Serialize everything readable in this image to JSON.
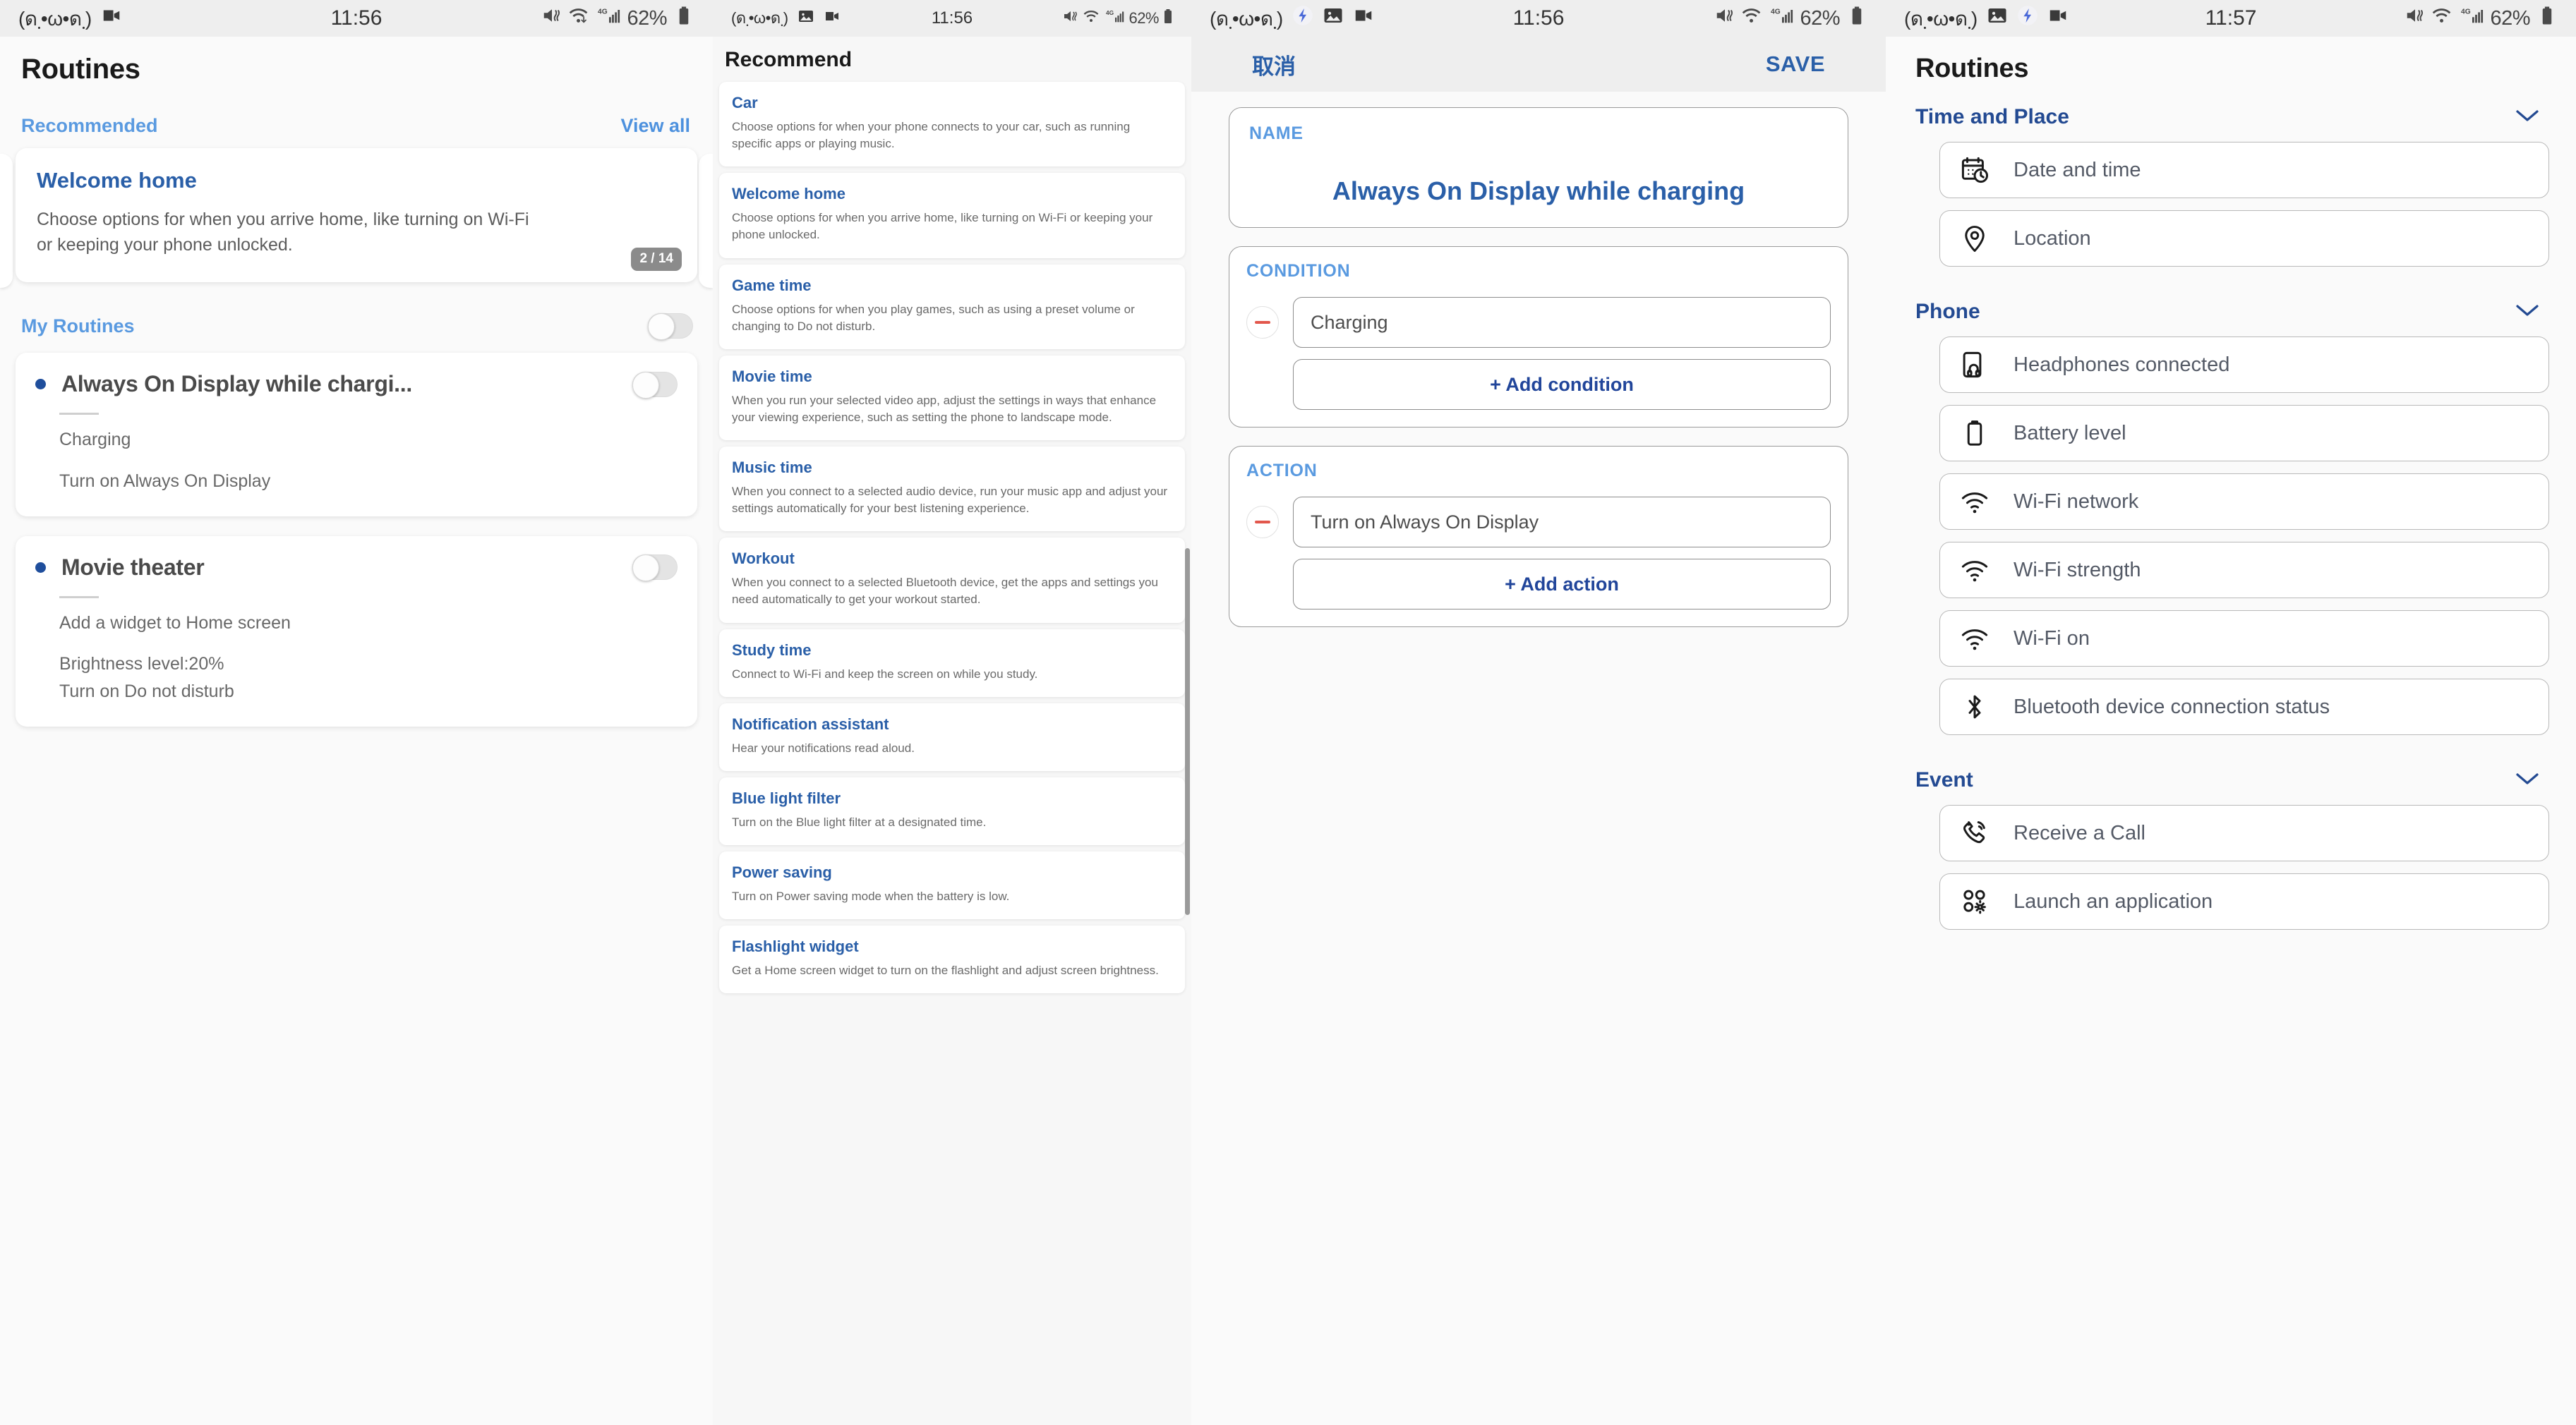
{
  "statusbar": {
    "emoticon": "(ด຺•ω•ด຺)",
    "time_1156": "11:56",
    "time_1157": "11:57",
    "battery_text": "62%",
    "icons_left_p1": [
      "video-camera-icon"
    ],
    "icons_left_p2": [
      "image-icon",
      "video-camera-icon"
    ],
    "icons_left_p3": [
      "routines-app-icon",
      "image-icon",
      "video-camera-icon"
    ],
    "icons_left_p4": [
      "image-icon",
      "routines-app-icon",
      "video-camera-icon"
    ],
    "icons_right": [
      "mute-vibrate-icon",
      "wifi-transfer-icon",
      "signal-4g-icon",
      "battery-icon"
    ],
    "network_label": "4G"
  },
  "panel1": {
    "title": "Routines",
    "recommended_label": "Recommended",
    "view_all_label": "View all",
    "recommended_card": {
      "title": "Welcome home",
      "description": "Choose options for when you arrive home, like turning on Wi-Fi or keeping your phone unlocked.",
      "counter": "2 / 14"
    },
    "my_routines_label": "My Routines",
    "my_routines_toggle": "off",
    "routines": [
      {
        "name": "Always On Display while chargi...",
        "toggle": "off",
        "lines": [
          "Charging",
          "Turn on Always On Display"
        ]
      },
      {
        "name": "Movie theater",
        "toggle": "off",
        "lines": [
          "Add a widget to Home screen",
          "Brightness level:20%",
          "Turn on Do not disturb"
        ]
      }
    ]
  },
  "panel2": {
    "title": "Recommend",
    "cards": [
      {
        "title": "Car",
        "description": "Choose options for when your phone connects to your car, such as running specific apps or playing music."
      },
      {
        "title": "Welcome home",
        "description": "Choose options for when you arrive home, like turning on Wi-Fi or keeping your phone unlocked."
      },
      {
        "title": "Game time",
        "description": "Choose options for when you play games, such as using a preset volume or changing to Do not disturb."
      },
      {
        "title": "Movie time",
        "description": "When you run your selected video app, adjust the settings in ways that enhance your viewing experience, such as setting the phone to landscape mode."
      },
      {
        "title": "Music time",
        "description": "When you connect to a selected audio device, run your music app and adjust your settings automatically for your best listening experience."
      },
      {
        "title": "Workout",
        "description": "When you connect to a selected Bluetooth device, get the apps and settings you need automatically to get your workout started."
      },
      {
        "title": "Study time",
        "description": "Connect to Wi-Fi and keep the screen on while you study."
      },
      {
        "title": "Notification assistant",
        "description": "Hear your notifications read aloud."
      },
      {
        "title": "Blue light filter",
        "description": "Turn on the Blue light filter at a designated time."
      },
      {
        "title": "Power saving",
        "description": "Turn on Power saving mode when the battery is low."
      },
      {
        "title": "Flashlight widget",
        "description": "Get a Home screen widget to turn on the flashlight and adjust screen brightness."
      }
    ]
  },
  "panel3": {
    "cancel_label": "取消",
    "save_label": "SAVE",
    "name_label": "NAME",
    "name_value": "Always On Display while charging",
    "condition_label": "CONDITION",
    "condition_value": "Charging",
    "add_condition_label": "+ Add condition",
    "action_label": "ACTION",
    "action_value": "Turn on Always On Display",
    "add_action_label": "+ Add action"
  },
  "panel4": {
    "title": "Routines",
    "groups": [
      {
        "title": "Time and Place",
        "expanded": true,
        "items": [
          {
            "label": "Date and time",
            "icon": "calendar-clock-icon"
          },
          {
            "label": "Location",
            "icon": "location-pin-icon"
          }
        ]
      },
      {
        "title": "Phone",
        "expanded": true,
        "items": [
          {
            "label": "Headphones connected",
            "icon": "headphones-icon"
          },
          {
            "label": "Battery level",
            "icon": "battery-icon"
          },
          {
            "label": "Wi-Fi network",
            "icon": "wifi-icon"
          },
          {
            "label": "Wi-Fi strength",
            "icon": "wifi-icon"
          },
          {
            "label": "Wi-Fi on",
            "icon": "wifi-icon"
          },
          {
            "label": "Bluetooth device connection status",
            "icon": "bluetooth-icon"
          }
        ]
      },
      {
        "title": "Event",
        "expanded": true,
        "items": [
          {
            "label": "Receive a Call",
            "icon": "phone-call-icon"
          },
          {
            "label": "Launch an application",
            "icon": "apps-gear-icon"
          }
        ]
      }
    ]
  },
  "colors": {
    "accent_blue": "#2a5fa8",
    "light_blue": "#5a9ae0",
    "deep_blue": "#234a92",
    "red_minus": "#e2574c",
    "bullet_blue": "#1f4e9c"
  }
}
